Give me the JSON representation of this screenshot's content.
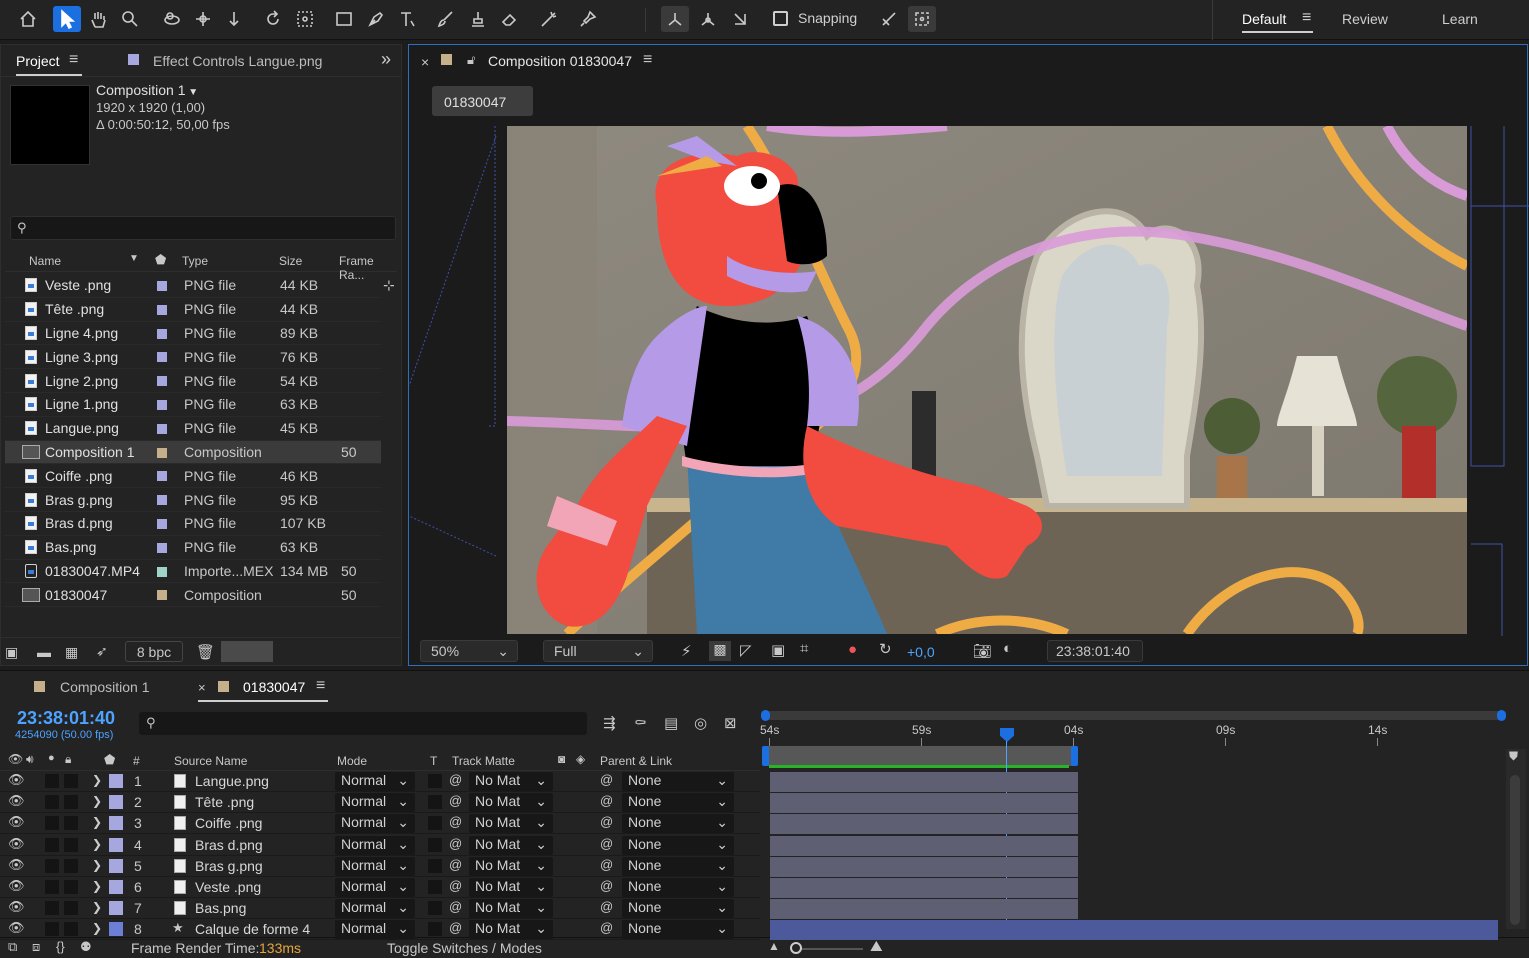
{
  "toolbar": {
    "snapping_label": "Snapping",
    "workspaces": [
      "Default",
      "Review",
      "Learn"
    ]
  },
  "project_panel": {
    "tab_project": "Project",
    "tab_effect": "Effect Controls Langue.png",
    "preview": {
      "name": "Composition 1",
      "dims": "1920 x 1920 (1,00)",
      "duration": "Δ 0:00:50:12, 50,00 fps"
    },
    "search_placeholder": "",
    "columns": {
      "name": "Name",
      "type": "Type",
      "size": "Size",
      "frame_rate": "Frame Ra..."
    },
    "items": [
      {
        "name": "Veste .png",
        "type": "PNG file",
        "size": "44 KB",
        "fr": "",
        "kind": "file",
        "color": "#a7a7e0"
      },
      {
        "name": "Tête .png",
        "type": "PNG file",
        "size": "44 KB",
        "fr": "",
        "kind": "file",
        "color": "#a7a7e0"
      },
      {
        "name": "Ligne 4.png",
        "type": "PNG file",
        "size": "89 KB",
        "fr": "",
        "kind": "file",
        "color": "#a7a7e0"
      },
      {
        "name": "Ligne 3.png",
        "type": "PNG file",
        "size": "76 KB",
        "fr": "",
        "kind": "file",
        "color": "#a7a7e0"
      },
      {
        "name": "Ligne 2.png",
        "type": "PNG file",
        "size": "54 KB",
        "fr": "",
        "kind": "file",
        "color": "#a7a7e0"
      },
      {
        "name": "Ligne 1.png",
        "type": "PNG file",
        "size": "63 KB",
        "fr": "",
        "kind": "file",
        "color": "#a7a7e0"
      },
      {
        "name": "Langue.png",
        "type": "PNG file",
        "size": "45 KB",
        "fr": "",
        "kind": "file",
        "color": "#a7a7e0"
      },
      {
        "name": "Composition 1",
        "type": "Composition",
        "size": "",
        "fr": "50",
        "kind": "comp",
        "color": "#c6b08c"
      },
      {
        "name": "Coiffe .png",
        "type": "PNG file",
        "size": "46 KB",
        "fr": "",
        "kind": "file",
        "color": "#a7a7e0"
      },
      {
        "name": "Bras g.png",
        "type": "PNG file",
        "size": "95 KB",
        "fr": "",
        "kind": "file",
        "color": "#a7a7e0"
      },
      {
        "name": "Bras d.png",
        "type": "PNG file",
        "size": "107 KB",
        "fr": "",
        "kind": "file",
        "color": "#a7a7e0"
      },
      {
        "name": "Bas.png",
        "type": "PNG file",
        "size": "63 KB",
        "fr": "",
        "kind": "file",
        "color": "#a7a7e0"
      },
      {
        "name": "01830047.MP4",
        "type": "Importe...MEX",
        "size": "134 MB",
        "fr": "50",
        "kind": "video",
        "color": "#9fd3c7"
      },
      {
        "name": "01830047",
        "type": "Composition",
        "size": "",
        "fr": "50",
        "kind": "comp",
        "color": "#c6b08c"
      }
    ],
    "bpc": "8 bpc"
  },
  "comp_panel": {
    "title": "Composition 01830047",
    "tab_chip": "01830047",
    "zoom": "50%",
    "resolution": "Full",
    "exposure": "+0,0",
    "timecode": "23:38:01:40"
  },
  "timeline": {
    "tabs": [
      "Composition 1",
      "01830047"
    ],
    "timecode": "23:38:01:40",
    "frame_info": "4254090 (50.00 fps)",
    "columns": {
      "hash": "#",
      "source": "Source Name",
      "mode": "Mode",
      "t": "T",
      "track_matte": "Track Matte",
      "parent": "Parent & Link"
    },
    "ruler": [
      "54s",
      "59s",
      "04s",
      "09s",
      "14s"
    ],
    "layers": [
      {
        "num": "1",
        "name": "Langue.png",
        "mode": "Normal",
        "matte": "No Mat",
        "parent": "None",
        "color": "#a7a7e0"
      },
      {
        "num": "2",
        "name": "Tête .png",
        "mode": "Normal",
        "matte": "No Mat",
        "parent": "None",
        "color": "#a7a7e0"
      },
      {
        "num": "3",
        "name": "Coiffe .png",
        "mode": "Normal",
        "matte": "No Mat",
        "parent": "None",
        "color": "#a7a7e0"
      },
      {
        "num": "4",
        "name": "Bras d.png",
        "mode": "Normal",
        "matte": "No Mat",
        "parent": "None",
        "color": "#a7a7e0"
      },
      {
        "num": "5",
        "name": "Bras g.png",
        "mode": "Normal",
        "matte": "No Mat",
        "parent": "None",
        "color": "#a7a7e0"
      },
      {
        "num": "6",
        "name": "Veste .png",
        "mode": "Normal",
        "matte": "No Mat",
        "parent": "None",
        "color": "#a7a7e0"
      },
      {
        "num": "7",
        "name": "Bas.png",
        "mode": "Normal",
        "matte": "No Mat",
        "parent": "None",
        "color": "#a7a7e0"
      },
      {
        "num": "8",
        "name": "Calque de forme 4",
        "mode": "Normal",
        "matte": "No Mat",
        "parent": "None",
        "color": "#6b7fd6"
      }
    ],
    "frame_render_label": "Frame Render Time:",
    "frame_render_value": "133ms",
    "toggle_label": "Toggle Switches / Modes"
  }
}
